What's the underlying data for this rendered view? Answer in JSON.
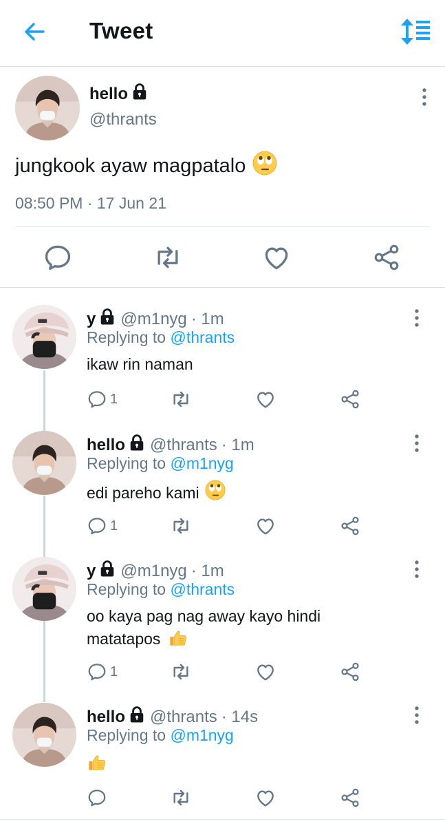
{
  "header": {
    "title": "Tweet"
  },
  "main_tweet": {
    "name": "hello",
    "handle": "@thrants",
    "text": "jungkook ayaw magpatalo",
    "timestamp": "08:50 PM · 17 Jun 21"
  },
  "replies": [
    {
      "name": "y",
      "handle": "@m1nyg",
      "time": "· 1m",
      "replying_prefix": "Replying to ",
      "replying_to": "@thrants",
      "text": "ikaw rin naman",
      "reply_count": "1"
    },
    {
      "name": "hello",
      "handle": "@thrants",
      "time": "· 1m",
      "replying_prefix": "Replying to ",
      "replying_to": "@m1nyg",
      "text": "edi pareho kami",
      "reply_count": "1"
    },
    {
      "name": "y",
      "handle": "@m1nyg",
      "time": "· 1m",
      "replying_prefix": "Replying to ",
      "replying_to": "@thrants",
      "text": "oo kaya pag nag away kayo hindi matatapos",
      "reply_count": "1"
    },
    {
      "name": "hello",
      "handle": "@thrants",
      "time": "· 14s",
      "replying_prefix": "Replying to ",
      "replying_to": "@m1nyg",
      "text": "",
      "reply_count": ""
    }
  ],
  "colors": {
    "accent": "#1da1f2",
    "secondary_text": "#657786",
    "icon": "#657786"
  },
  "icons": [
    "back-arrow-icon",
    "sort-icon",
    "lock-icon",
    "more-icon",
    "reply-icon",
    "retweet-icon",
    "like-icon",
    "share-icon",
    "eye-roll-emoji",
    "thumbs-up-emoji"
  ]
}
